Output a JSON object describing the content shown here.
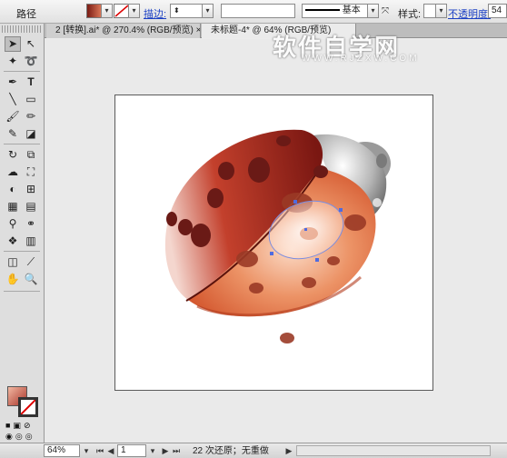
{
  "control_bar": {
    "object_type": "路径",
    "stroke_label": "描边:",
    "stroke_weight": "",
    "stroke_profile": "基本",
    "style_label": "样式:",
    "opacity_label": "不透明度:",
    "opacity_value": "54",
    "fill_color": "#c9583a",
    "stroke_color": "none"
  },
  "tabs": [
    {
      "label": "2 [转换].ai* @ 270.4% (RGB/预览)"
    },
    {
      "label": "未标题-4* @ 64% (RGB/预览)"
    }
  ],
  "watermark": {
    "text": "软件自学网",
    "sub": "WWW.RJZXW.COM"
  },
  "toolbox": {
    "tools": [
      "selection-icon",
      "direct-selection-icon",
      "magic-wand-icon",
      "lasso-icon",
      "pen-icon",
      "type-icon",
      "line-icon",
      "rectangle-icon",
      "paintbrush-icon",
      "pencil-icon",
      "blob-brush-icon",
      "eraser-icon",
      "rotate-icon",
      "scale-icon",
      "warp-icon",
      "free-transform-icon",
      "shape-builder-icon",
      "perspective-grid-icon",
      "mesh-icon",
      "gradient-icon",
      "eyedropper-icon",
      "blend-icon",
      "symbol-sprayer-icon",
      "column-graph-icon",
      "artboard-icon",
      "slice-icon",
      "hand-icon",
      "zoom-icon"
    ],
    "fill_swatch": "#c9583a",
    "stroke_swatch": "none"
  },
  "status_bar": {
    "zoom": "64%",
    "page": "1",
    "undo_status": "22 次还原；无重做"
  }
}
